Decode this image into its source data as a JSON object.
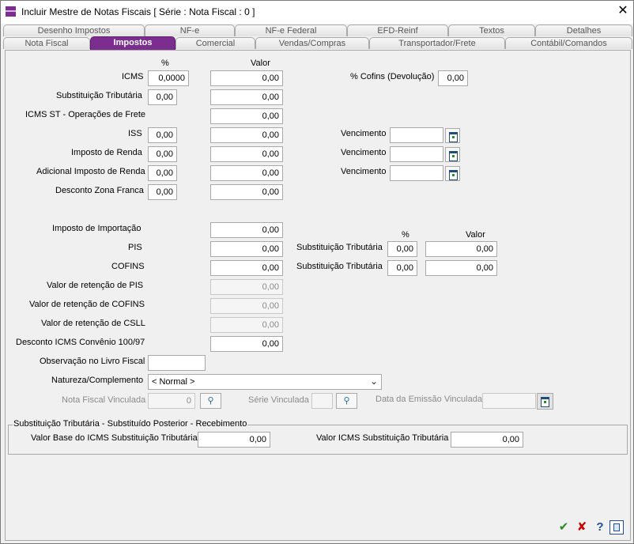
{
  "window": {
    "title": "Incluir Mestre de Notas Fiscais [ Série :      Nota Fiscal : 0 ]"
  },
  "tabs_row1": [
    "Desenho Impostos",
    "NF-e",
    "NF-e Federal",
    "EFD-Reinf",
    "Textos",
    "Detalhes"
  ],
  "tabs_row2": [
    "Nota Fiscal",
    "Impostos",
    "Comercial",
    "Vendas/Compras",
    "Transportador/Frete",
    "Contábil/Comandos"
  ],
  "headers": {
    "pct": "%",
    "valor": "Valor",
    "pct2": "%",
    "valor2": "Valor"
  },
  "rows": {
    "icms": {
      "label": "ICMS",
      "pct": "0,0000",
      "valor": "0,00"
    },
    "subst": {
      "label": "Substituição Tributária",
      "pct": "0,00",
      "valor": "0,00"
    },
    "icms_st_frete": {
      "label": "ICMS ST - Operações de Frete",
      "valor": "0,00"
    },
    "iss": {
      "label": "ISS",
      "pct": "0,00",
      "valor": "0,00"
    },
    "ir": {
      "label": "Imposto de Renda",
      "pct": "0,00",
      "valor": "0,00"
    },
    "adic_ir": {
      "label": "Adicional Imposto de Renda",
      "pct": "0,00",
      "valor": "0,00"
    },
    "zona_franca": {
      "label": "Desconto Zona Franca",
      "pct": "0,00",
      "valor": "0,00"
    },
    "importacao": {
      "label": "Imposto de Importação",
      "valor": "0,00"
    },
    "pis": {
      "label": "PIS",
      "valor": "0,00"
    },
    "cofins": {
      "label": "COFINS",
      "valor": "0,00"
    },
    "ret_pis": {
      "label": "Valor de retenção de PIS",
      "valor": "0,00"
    },
    "ret_cofins": {
      "label": "Valor de retenção de COFINS",
      "valor": "0,00"
    },
    "ret_csll": {
      "label": "Valor de retenção de CSLL",
      "valor": "0,00"
    },
    "desc_icms_conv": {
      "label": "Desconto ICMS Convênio 100/97",
      "valor": "0,00"
    }
  },
  "cofins_dev": {
    "label": "% Cofins (Devolução)",
    "value": "0,00"
  },
  "vencimento": {
    "label": "Vencimento"
  },
  "st_pis": {
    "label": "Substituição Tributária",
    "pct": "0,00",
    "valor": "0,00"
  },
  "st_cofins": {
    "label": "Substituição Tributária",
    "pct": "0,00",
    "valor": "0,00"
  },
  "obs_livro": {
    "label": "Observação no Livro Fiscal",
    "value": ""
  },
  "natureza": {
    "label": "Natureza/Complemento",
    "value": "< Normal >"
  },
  "nf_vinc": {
    "label": "Nota Fiscal Vinculada",
    "value": "0"
  },
  "serie_vinc": {
    "label": "Série Vinculada",
    "value": ""
  },
  "data_emissao": {
    "label": "Data da Emissão Vinculada"
  },
  "group": {
    "title": "Substituição Tributária - Substituído Posterior - Recebimento",
    "base_label": "Valor Base do ICMS Substituição Tributária",
    "base_value": "0,00",
    "icms_label": "Valor ICMS Substituição Tributária",
    "icms_value": "0,00"
  },
  "footer": {
    "ok": "✔",
    "cancel": "✘",
    "help": "?"
  },
  "colors": {
    "accent": "#7b2e8e",
    "ok": "#2c8a2c",
    "cancel": "#cc0000",
    "help": "#1f4e9e"
  }
}
